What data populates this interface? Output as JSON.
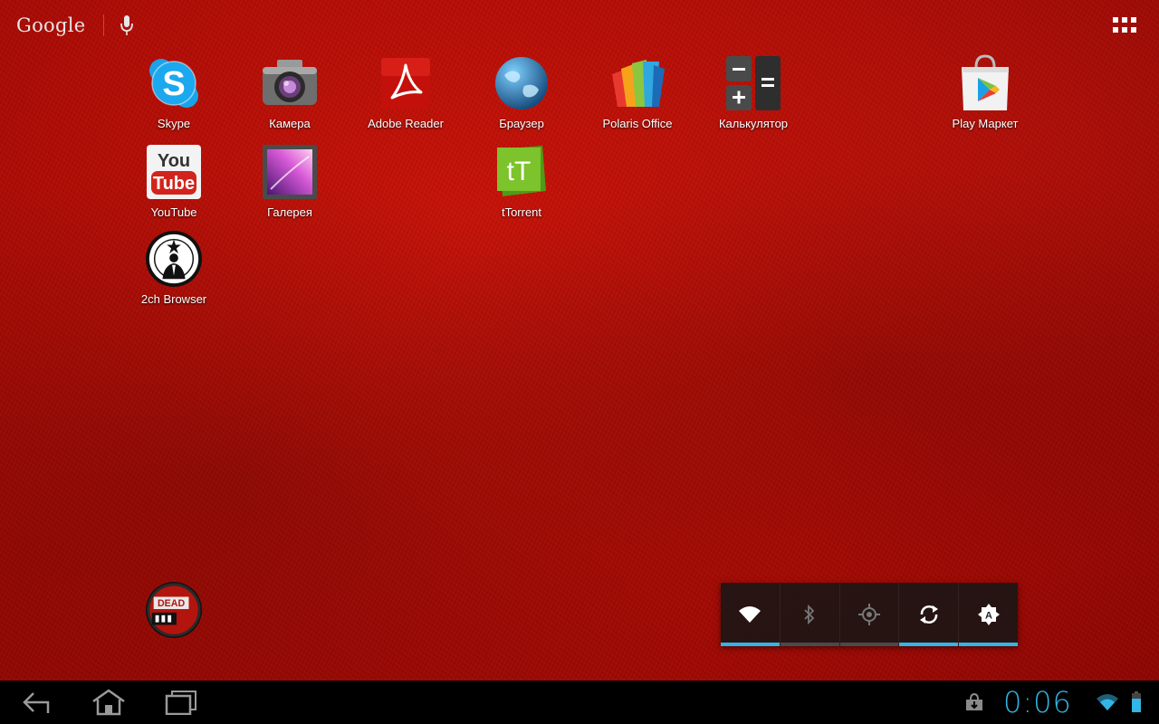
{
  "search": {
    "logo_text": "Google"
  },
  "desktop": {
    "shortcuts": [
      {
        "label": "Skype",
        "icon": "skype-icon"
      },
      {
        "label": "Камера",
        "icon": "camera-icon"
      },
      {
        "label": "Adobe Reader",
        "icon": "adobe-reader-icon"
      },
      {
        "label": "Браузер",
        "icon": "browser-globe-icon"
      },
      {
        "label": "Polaris Office",
        "icon": "polaris-office-icon"
      },
      {
        "label": "Калькулятор",
        "icon": "calculator-icon"
      },
      {
        "label": "Play Маркет",
        "icon": "play-store-icon"
      },
      {
        "label": "YouTube",
        "icon": "youtube-icon"
      },
      {
        "label": "Галерея",
        "icon": "gallery-icon"
      },
      {
        "label": "tTorrent",
        "icon": "ttorrent-icon"
      },
      {
        "label": "2ch Browser",
        "icon": "2ch-browser-icon"
      }
    ],
    "unlabeled_icon": "dead-trigger-icon"
  },
  "power_widget": {
    "toggles": [
      {
        "name": "wifi",
        "icon": "wifi-icon",
        "on": true
      },
      {
        "name": "bluetooth",
        "icon": "bluetooth-icon",
        "on": false
      },
      {
        "name": "gps",
        "icon": "gps-icon",
        "on": false
      },
      {
        "name": "sync",
        "icon": "sync-icon",
        "on": true
      },
      {
        "name": "brightness",
        "icon": "brightness-auto-icon",
        "on": true
      }
    ]
  },
  "system_bar": {
    "time": "0:06",
    "nav": [
      "back-icon",
      "home-icon",
      "recent-apps-icon"
    ],
    "status": [
      "download-notification-icon",
      "wifi-signal-icon",
      "battery-icon"
    ]
  },
  "colors": {
    "accent": "#33b5e5",
    "wallpaper": "#b00e08"
  }
}
